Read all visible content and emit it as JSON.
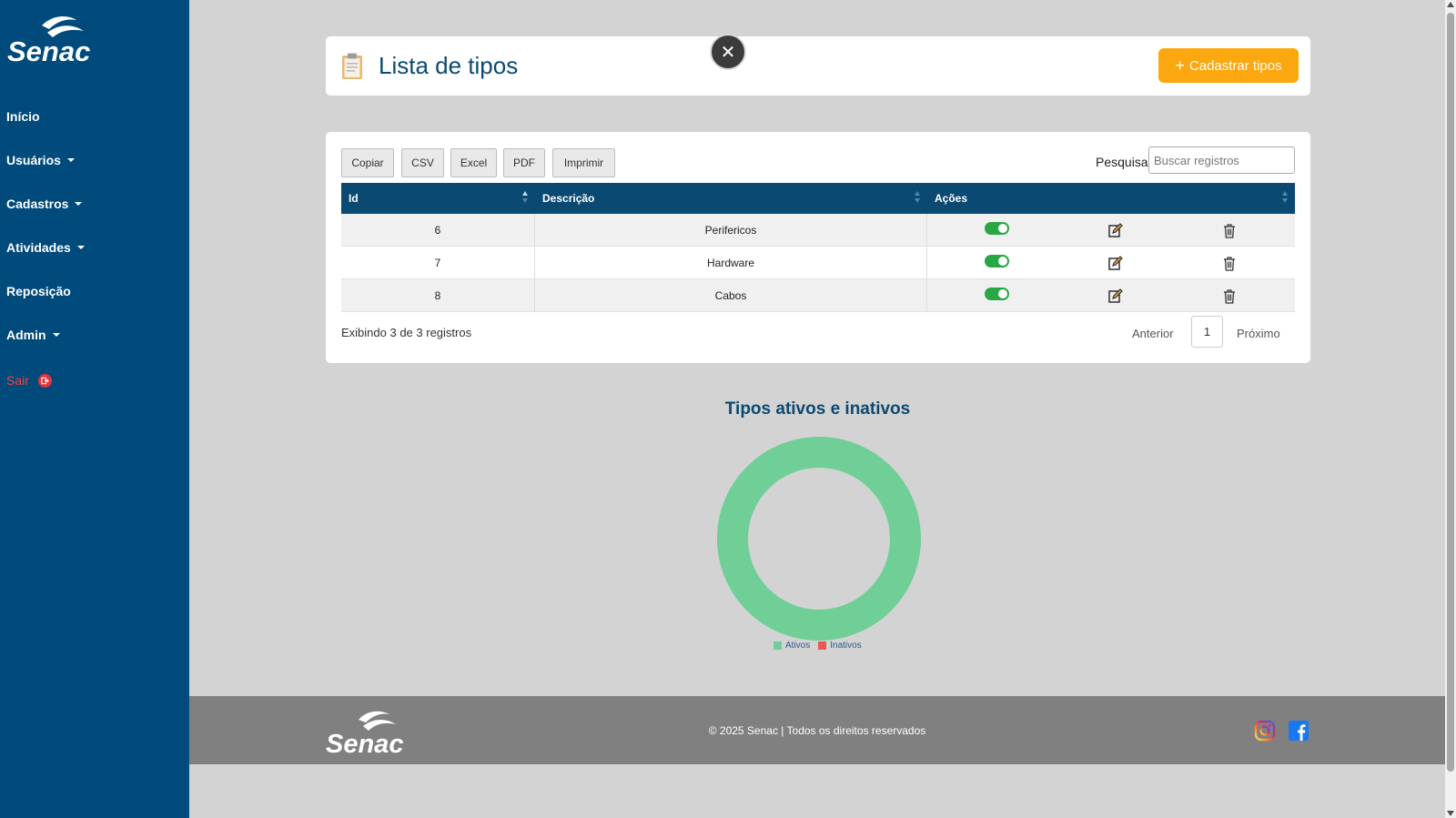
{
  "brand": {
    "logo_text": "Senac"
  },
  "sidebar": {
    "items": [
      {
        "label": "Início",
        "dropdown": false
      },
      {
        "label": "Usuários",
        "dropdown": true
      },
      {
        "label": "Cadastros",
        "dropdown": true
      },
      {
        "label": "Atividades",
        "dropdown": true
      },
      {
        "label": "Reposição",
        "dropdown": false
      },
      {
        "label": "Admin",
        "dropdown": true
      }
    ],
    "logout_label": "Sair"
  },
  "header": {
    "title": "Lista de tipos",
    "add_button": "Cadastrar tipos",
    "close_symbol": "✕"
  },
  "toolbar": {
    "buttons": [
      "Copiar",
      "CSV",
      "Excel",
      "PDF",
      "Imprimir"
    ],
    "search_label": "Pesquisar",
    "search_placeholder": "Buscar registros"
  },
  "table": {
    "columns": [
      "Id",
      "Descrição",
      "Ações"
    ],
    "rows": [
      {
        "id": "6",
        "descricao": "Perifericos",
        "ativo": true
      },
      {
        "id": "7",
        "descricao": "Hardware",
        "ativo": true
      },
      {
        "id": "8",
        "descricao": "Cabos",
        "ativo": true
      }
    ],
    "info": "Exibindo 3 de 3 registros",
    "pagination": {
      "prev": "Anterior",
      "page": "1",
      "next": "Próximo"
    }
  },
  "chart_data": {
    "type": "pie",
    "title": "Tipos ativos e inativos",
    "categories": [
      "Ativos",
      "Inativos"
    ],
    "values": [
      3,
      0
    ],
    "colors": [
      "#6fcf97",
      "#eb5757"
    ],
    "legend": "bottom"
  },
  "footer": {
    "copyright": "© 2025 Senac | Todos os direitos reservados",
    "social": [
      "instagram-icon",
      "facebook-icon"
    ]
  },
  "colors": {
    "sidebar": "#004a7c",
    "accent": "#fba70f",
    "title": "#0a4a72",
    "footer": "#808080",
    "toggle_on": "#28a745",
    "logout": "#ff3b3b"
  }
}
